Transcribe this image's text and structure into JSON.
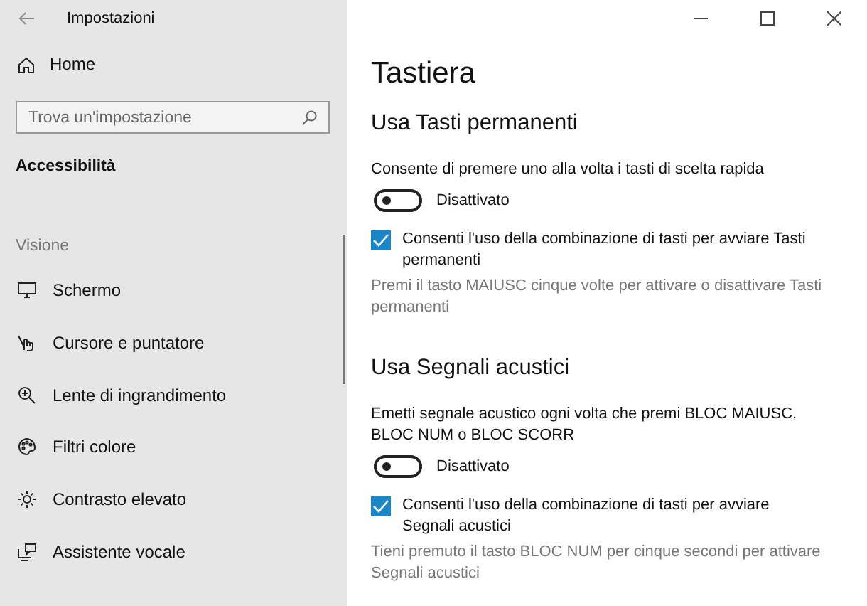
{
  "window": {
    "title": "Impostazioni"
  },
  "sidebar": {
    "home": "Home",
    "search": {
      "placeholder": "Trova un'impostazione"
    },
    "section": "Accessibilità",
    "group": "Visione",
    "items": [
      {
        "label": "Schermo",
        "selected": false
      },
      {
        "label": "Cursore e puntatore",
        "selected": false
      },
      {
        "label": "Lente di ingrandimento",
        "selected": false
      },
      {
        "label": "Filtri colore",
        "selected": false
      },
      {
        "label": "Contrasto elevato",
        "selected": false
      },
      {
        "label": "Assistente vocale",
        "selected": false
      }
    ]
  },
  "content": {
    "title": "Tastiera",
    "sections": [
      {
        "heading": "Usa Tasti permanenti",
        "description": "Consente di premere uno alla volta i tasti di scelta rapida",
        "toggle": {
          "on": false,
          "label": "Disattivato"
        },
        "shortcut": {
          "checked": true,
          "label": "Consenti l'uso della combinazione di tasti per avviare Tasti permanenti"
        },
        "hint": "Premi il tasto MAIUSC cinque volte per attivare o disattivare Tasti permanenti"
      },
      {
        "heading": "Usa Segnali acustici",
        "description": "Emetti segnale acustico ogni volta che premi BLOC MAIUSC, BLOC NUM o BLOC SCORR",
        "toggle": {
          "on": false,
          "label": "Disattivato"
        },
        "shortcut": {
          "checked": true,
          "label": "Consenti l'uso della combinazione di tasti per avviare Segnali acustici"
        },
        "hint": "Tieni premuto il tasto BLOC NUM per cinque secondi per attivare Segnali acustici"
      }
    ]
  }
}
